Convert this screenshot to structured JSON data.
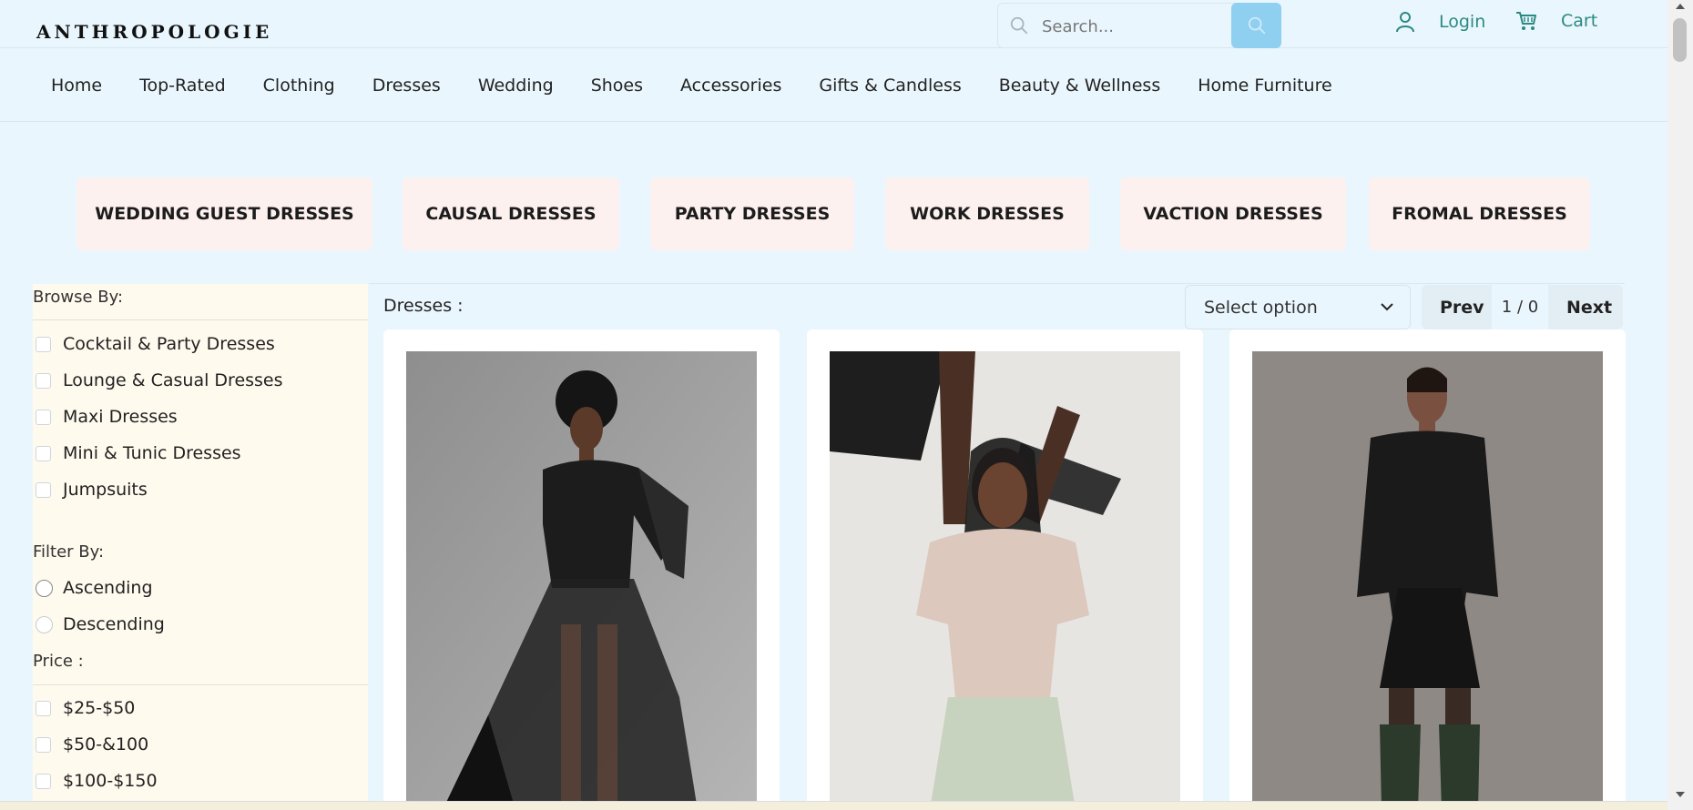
{
  "brand": {
    "logo": "ANTHROPOLOGIE"
  },
  "header": {
    "search_placeholder": "Search...",
    "login_label": "Login",
    "cart_label": "Cart",
    "search_button_color": "#8fd0f0",
    "accent_color": "#2a8a82"
  },
  "nav": {
    "items": [
      "Home",
      "Top-Rated",
      "Clothing",
      "Dresses",
      "Wedding",
      "Shoes",
      "Accessories",
      "Gifts & Candless",
      "Beauty & Wellness",
      "Home Furniture"
    ]
  },
  "categories": [
    "WEDDING GUEST DRESSES",
    "CAUSAL DRESSES",
    "PARTY DRESSES",
    "WORK DRESSES",
    "VACTION DRESSES",
    "FROMAL DRESSES"
  ],
  "sidebar": {
    "browse_heading": "Browse By:",
    "browse_items": [
      "Cocktail & Party Dresses",
      "Lounge & Casual Dresses",
      "Maxi Dresses",
      "Mini & Tunic Dresses",
      "Jumpsuits"
    ],
    "filter_heading": "Filter By:",
    "filter_items": [
      "Ascending",
      "Descending"
    ],
    "price_heading": "Price :",
    "price_items": [
      "$25-$50",
      "$50-&100",
      "$100-$150"
    ]
  },
  "main": {
    "heading": "Dresses :",
    "sort_select": "Select option",
    "prev_label": "Prev",
    "page_info": "1 / 0",
    "next_label": "Next"
  },
  "products": [
    {
      "image": "woman-black-sheer-maxi-dress-leather-jacket"
    },
    {
      "image": "woman-pink-mesh-tee-green-skirt"
    },
    {
      "image": "woman-black-slip-dress-leather-jacket-boots"
    }
  ]
}
